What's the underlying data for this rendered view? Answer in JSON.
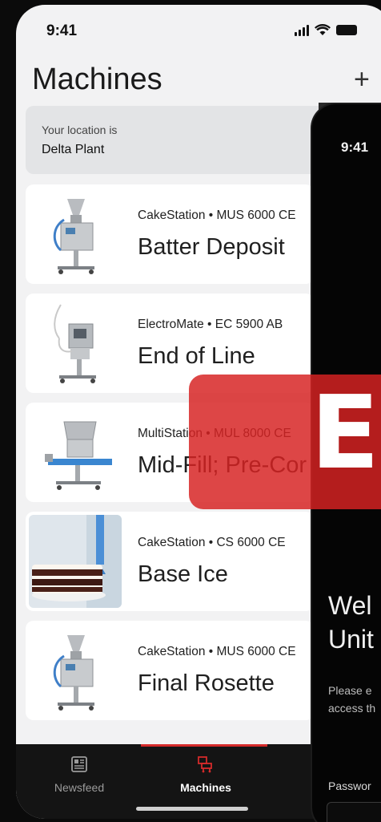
{
  "status_bar": {
    "time": "9:41"
  },
  "header": {
    "title": "Machines",
    "add_label": "+"
  },
  "location": {
    "label": "Your location is",
    "value": "Delta Plant"
  },
  "machines": [
    {
      "sub": "CakeStation • MUS 6000 CE",
      "name": "Batter Deposit",
      "image": "depositor-machine"
    },
    {
      "sub": "ElectroMate • EC 5900 AB",
      "name": "End of Line",
      "image": "dispenser-machine"
    },
    {
      "sub": "MultiStation • MUL 8000 CE",
      "name": "Mid-Fill; Pre-Cor",
      "image": "multistation-machine"
    },
    {
      "sub": "CakeStation • CS 6000 CE",
      "name": "Base Ice",
      "image": "cake-photo"
    },
    {
      "sub": "CakeStation • MUS 6000 CE",
      "name": "Final Rosette",
      "image": "depositor-machine"
    }
  ],
  "tabbar": {
    "tabs": [
      {
        "label": "Newsfeed",
        "icon": "newsfeed-icon",
        "active": false
      },
      {
        "label": "Machines",
        "icon": "machines-icon",
        "active": true
      }
    ],
    "accent": "#d42a2a"
  },
  "login_screen": {
    "time": "9:41",
    "welcome_line1": "Wel",
    "welcome_line2": "Unit",
    "desc_line1": "Please e",
    "desc_line2": "access th",
    "password_label": "Passwor"
  },
  "overlay": {
    "text": "EX",
    "color": "#d62222"
  }
}
